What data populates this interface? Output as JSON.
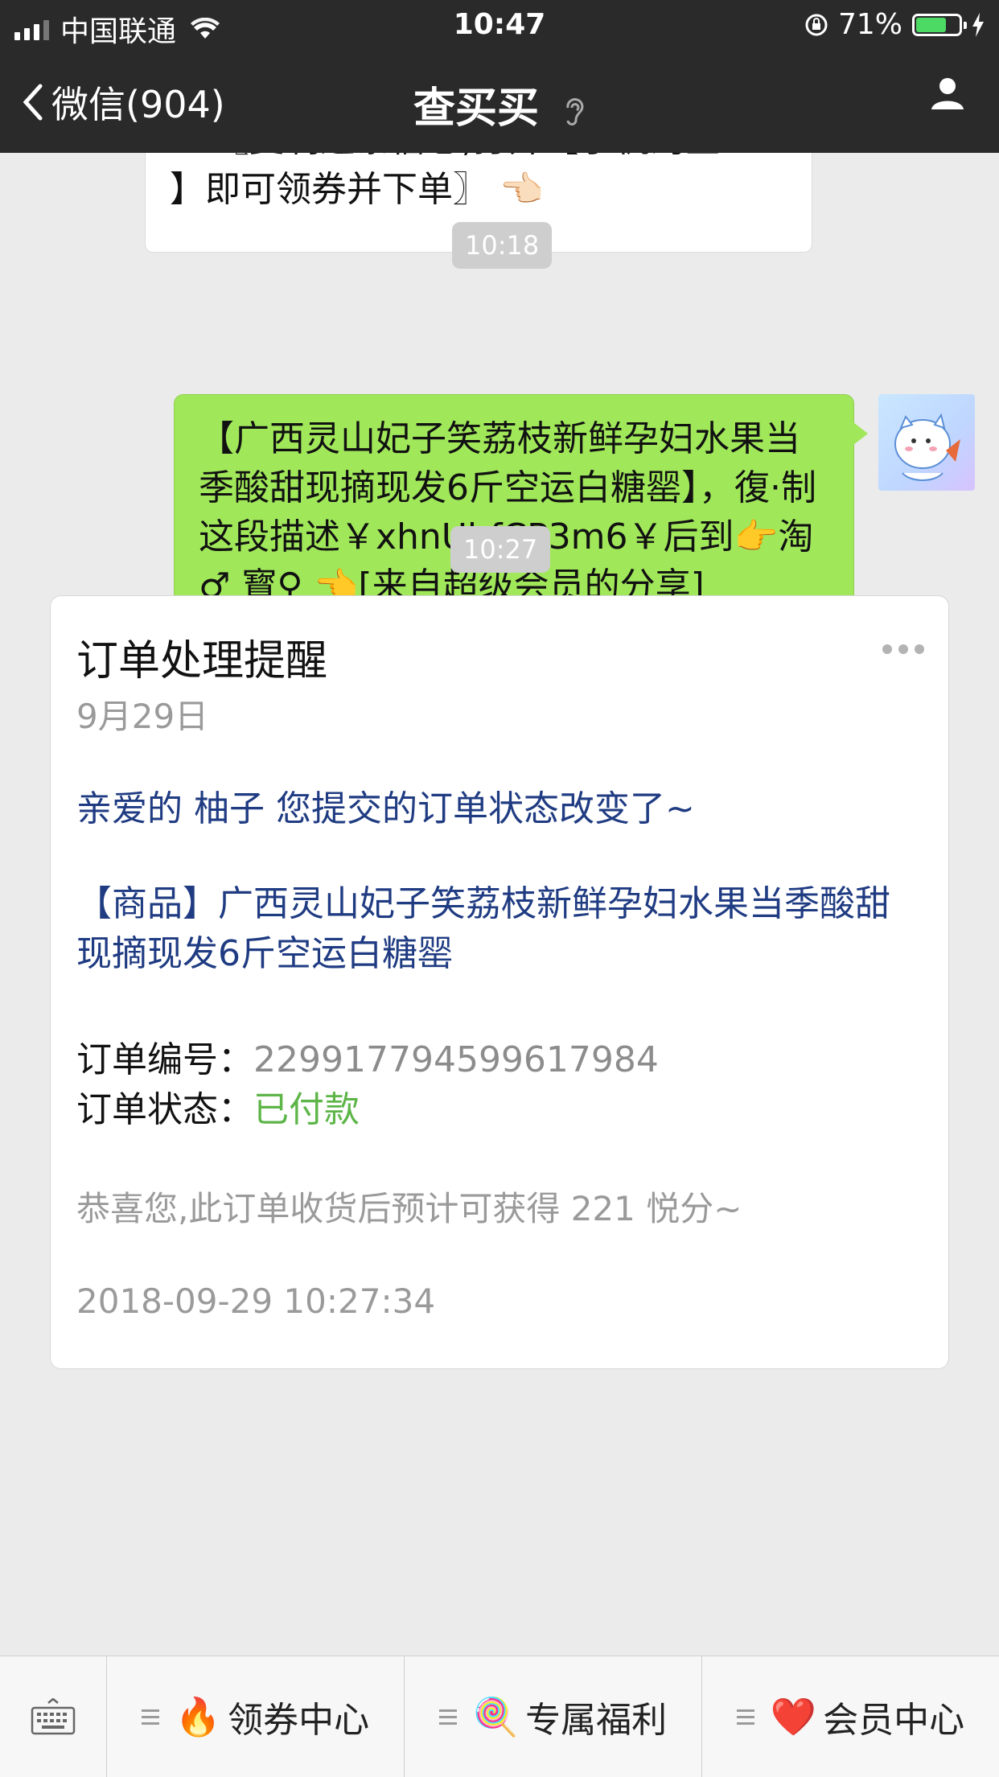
{
  "status_bar": {
    "carrier": "中国联通",
    "time": "10:47",
    "battery_percent": "71%",
    "battery_level": 0.71
  },
  "nav": {
    "back_label": "微信(904)",
    "title": "查买买"
  },
  "messages": {
    "incoming_partial": {
      "line1": "👉〖复制这条信息,打开【手机淘宝",
      "line2": "】即可领券并下单〗 👈🏻"
    },
    "ts1": "10:18",
    "outgoing": {
      "text": "【广西灵山妃子笑荔枝新鲜孕妇水果当季酸甜现摘现发6斤空运白糖罂】，復·制这段描述￥xhnUbfCP3m6￥后到👉淘♂ 寳♀ 👈[来自超级会员的分享]"
    },
    "ts2": "10:27"
  },
  "card": {
    "title": "订单处理提醒",
    "date": "9月29日",
    "greeting": "亲爱的 柚子 您提交的订单状态改变了~",
    "product": "【商品】广西灵山妃子笑荔枝新鲜孕妇水果当季酸甜现摘现发6斤空运白糖罂",
    "order_no_label": "订单编号：",
    "order_no": "229917794599617984",
    "status_label": "订单状态：",
    "status": "已付款",
    "note": "恭喜您,此订单收货后预计可获得 221 悦分~",
    "timestamp": "2018-09-29 10:27:34"
  },
  "bottom_menu": [
    {
      "emoji": "🔥",
      "label": "领券中心"
    },
    {
      "emoji": "🍭",
      "label": "专属福利"
    },
    {
      "emoji": "❤️",
      "label": "会员中心"
    }
  ]
}
